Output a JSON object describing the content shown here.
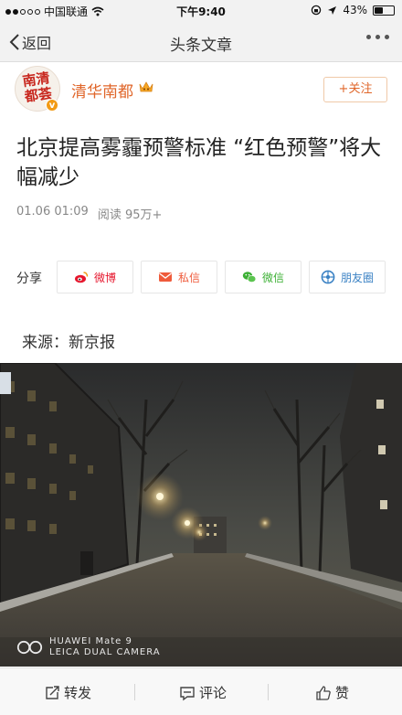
{
  "status_bar": {
    "carrier": "中国联通",
    "time": "下午9:40",
    "battery_percent": "43%",
    "battery_level": 0.43,
    "signal_dots_filled": 2,
    "signal_dots_total": 5
  },
  "nav": {
    "back_label": "返回",
    "title": "头条文章"
  },
  "author": {
    "avatar_text": "南清都荟",
    "verified_mark": "v",
    "name": "清华南都",
    "follow_label": "+关注",
    "accent_color": "#e0662a"
  },
  "article": {
    "title": "北京提高雾霾预警标准 “红色预警”将大幅减少",
    "date": "01.06 01:09",
    "reads": "阅读 95万+"
  },
  "share": {
    "label": "分享",
    "buttons": [
      {
        "label": "微博",
        "icon": "weibo-icon",
        "color": "#e6162d"
      },
      {
        "label": "私信",
        "icon": "mail-icon",
        "color": "#ef5b3b"
      },
      {
        "label": "微信",
        "icon": "wechat-icon",
        "color": "#3cb034"
      },
      {
        "label": "朋友圈",
        "icon": "moments-icon",
        "color": "#3b82c4"
      }
    ]
  },
  "source": {
    "label": "来源：",
    "value": "新京报"
  },
  "photo": {
    "watermark_line1": "HUAWEI Mate 9",
    "watermark_line2": "LEICA DUAL CAMERA"
  },
  "bottom_bar": {
    "repost_label": "转发",
    "comment_label": "评论",
    "like_label": "赞"
  }
}
